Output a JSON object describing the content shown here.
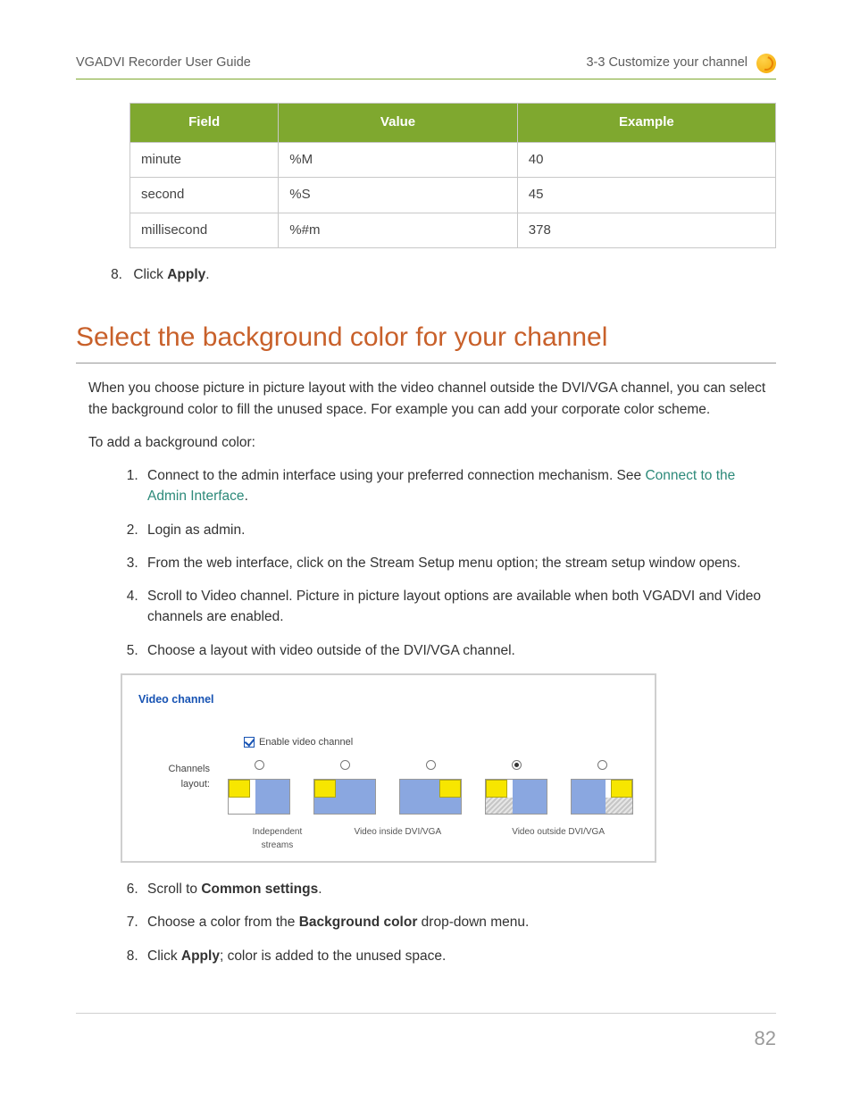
{
  "header": {
    "left": "VGADVI Recorder User Guide",
    "right": "3-3 Customize your channel"
  },
  "table": {
    "headers": {
      "field": "Field",
      "value": "Value",
      "example": "Example"
    },
    "rows": [
      {
        "field": "minute",
        "value": "%M",
        "example": "40"
      },
      {
        "field": "second",
        "value": "%S",
        "example": "45"
      },
      {
        "field": "millisecond",
        "value": "%#m",
        "example": "378"
      }
    ]
  },
  "step8_top": {
    "num": "8.",
    "prefix": "Click ",
    "bold": "Apply",
    "suffix": "."
  },
  "section_title": "Select the background color for your channel",
  "intro_para1": "When you choose picture in picture layout with the video channel outside the DVI/VGA channel, you can select the background color to fill the unused space. For example you can add your corporate color scheme.",
  "intro_para2": "To add a background color:",
  "steps_a": {
    "s1": {
      "prefix": "Connect to the admin interface using your preferred connection mechanism. See ",
      "link": "Connect to the Admin Interface",
      "suffix": "."
    },
    "s2": "Login as admin.",
    "s3": "From the web interface, click on the Stream Setup menu option; the stream setup window opens.",
    "s4": "Scroll to Video channel. Picture in picture layout options are available when both VGADVI and Video channels are enabled.",
    "s5": "Choose a layout with video outside of the DVI/VGA channel."
  },
  "vc_panel": {
    "title": "Video channel",
    "enable_label": "Enable video channel",
    "layouts_label": "Channels layout:",
    "group_labels": {
      "independent": "Independent streams",
      "inside": "Video inside DVI/VGA",
      "outside": "Video outside DVI/VGA"
    }
  },
  "steps_b": {
    "s6": {
      "prefix": "Scroll to ",
      "bold": "Common settings",
      "suffix": "."
    },
    "s7": {
      "prefix": "Choose a color from the ",
      "bold": "Background color",
      "suffix": " drop-down menu."
    },
    "s8": {
      "prefix": "Click ",
      "bold": "Apply",
      "suffix": "; color is added to the unused space."
    }
  },
  "page_number": "82"
}
